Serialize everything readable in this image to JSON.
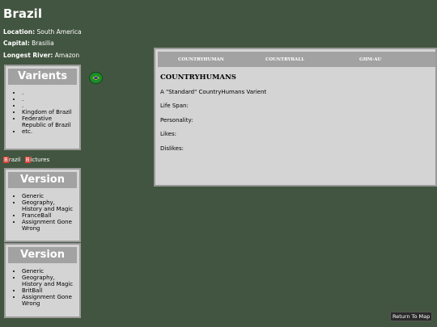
{
  "page": {
    "title": "Brazil",
    "location_label": "Location:",
    "location_value": "South America",
    "capital_label": "Capital:",
    "capital_value": "Brasilia",
    "river_label": "Longest River:",
    "river_value": "Amazon"
  },
  "variants": {
    "header": "Varients",
    "items": [
      ".",
      ".",
      ".",
      "Kingdom of Brazil",
      "Federative Republic of Brazil",
      "etc."
    ]
  },
  "links": [
    {
      "cap": "B",
      "rest": "razil"
    },
    {
      "cap": "B",
      "rest": "ictures"
    }
  ],
  "versions": [
    {
      "header": "Version",
      "items": [
        "Generic",
        "Geography, History and Magic",
        "FranceBall",
        "Assignment Gone Wrong"
      ]
    },
    {
      "header": "Version",
      "items": [
        "Generic",
        "Geography, History and Magic",
        "BritBall",
        "Assignment Gone Wrong"
      ]
    }
  ],
  "panel": {
    "tabs": [
      "COUNTRYHUMAN",
      "COUNTRYBALL",
      "GHM-AU"
    ],
    "title": "COUNTRYHUMANS",
    "description": "A \"Standard\" CountryHumans Varient",
    "fields": [
      "Life Span:",
      "Personality:",
      "Likes:",
      "Dislikes:"
    ]
  },
  "icons": {
    "flag": "brazil-flag-icon"
  },
  "footer": {
    "return_label": "Return To Map"
  },
  "colors": {
    "background": "#425540",
    "box": "#d4d4d4",
    "header": "#a2a2a2",
    "link_cap": "#d9443b"
  }
}
